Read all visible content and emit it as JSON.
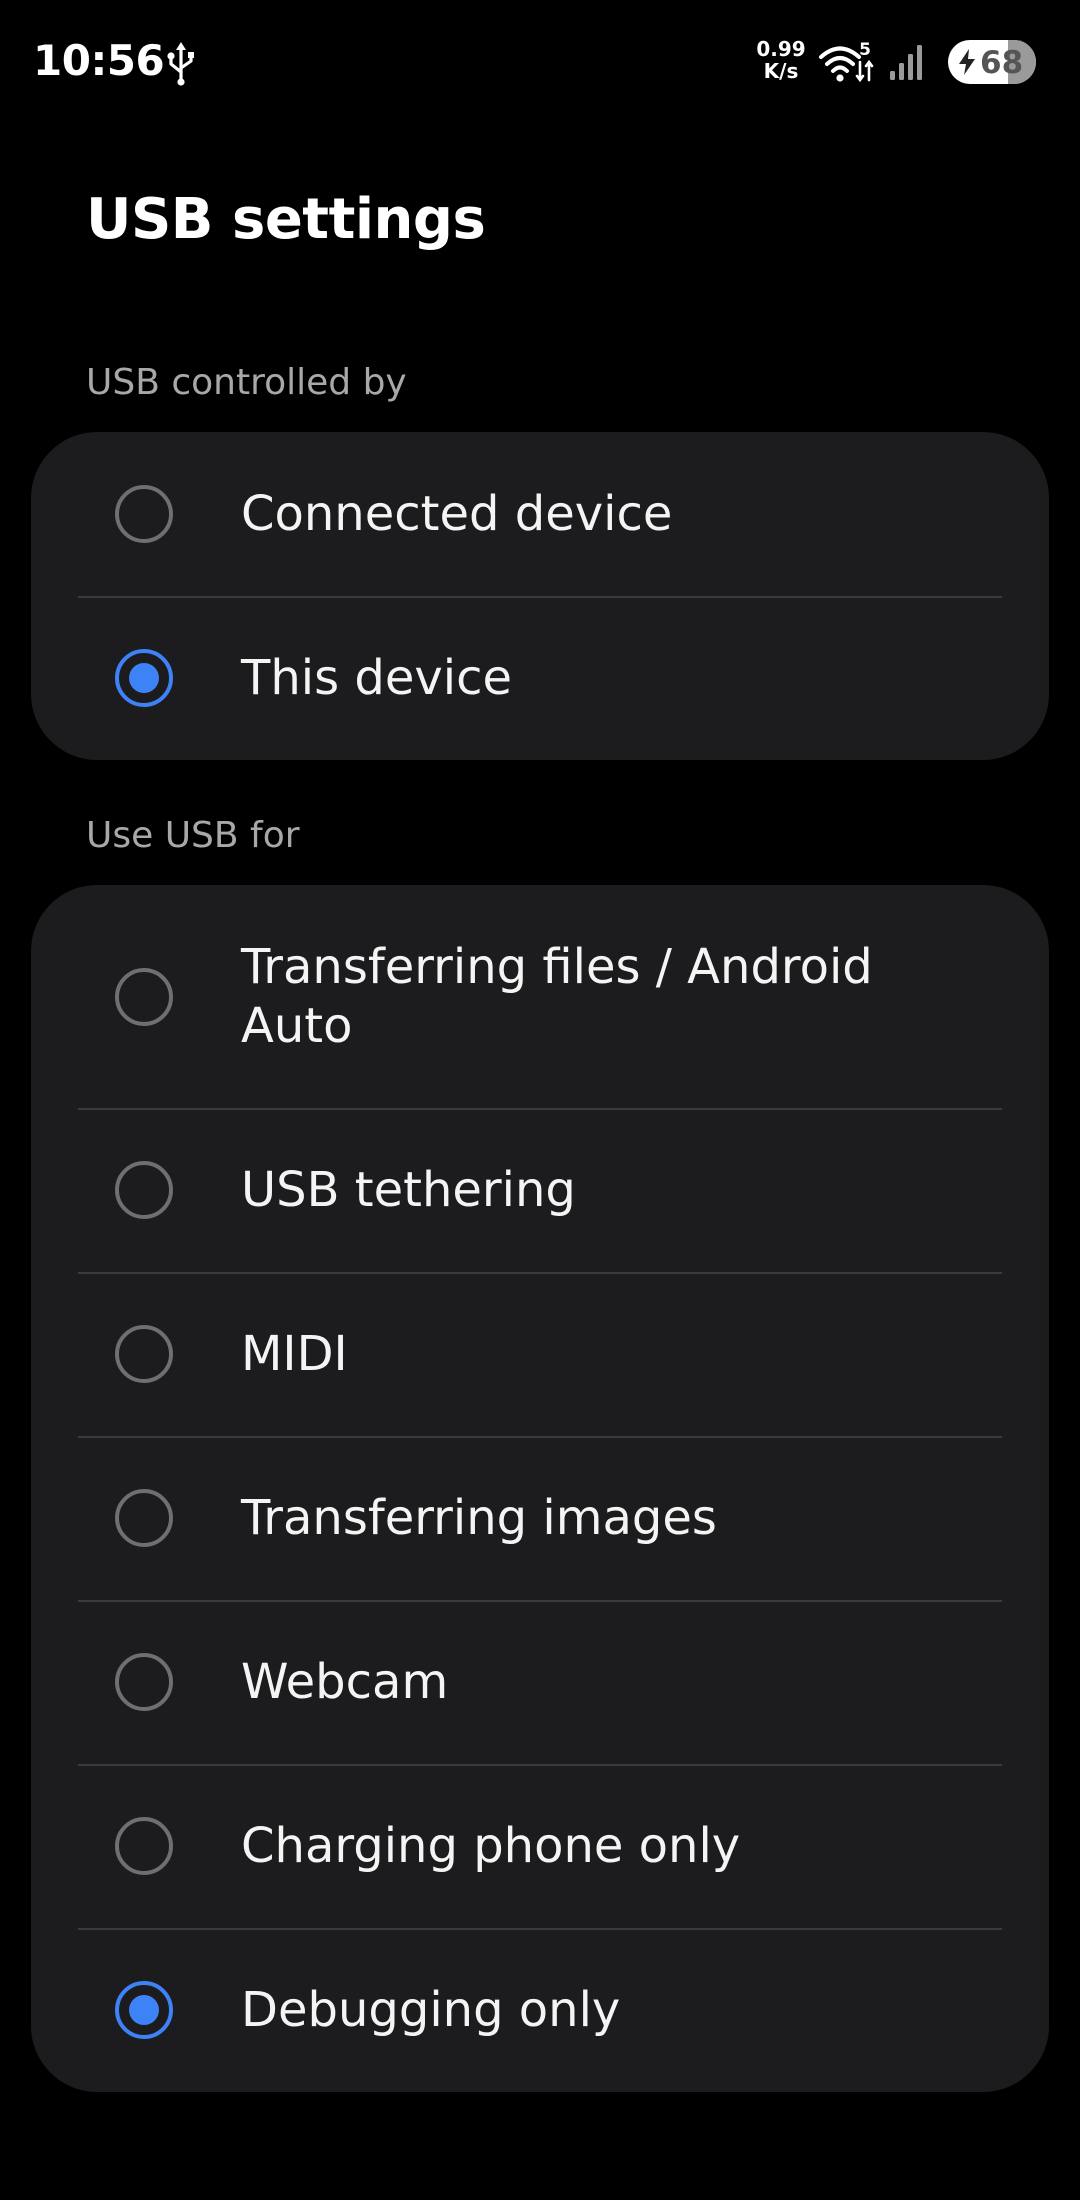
{
  "status_bar": {
    "time": "10:56",
    "usb_icon": "usb-icon",
    "net_speed_value": "0.99",
    "net_speed_unit": "K/s",
    "wifi_icon": "wifi-icon",
    "wifi_badge": "5",
    "signal_icon": "signal-icon",
    "battery_level": "68",
    "battery_fraction": 0.68,
    "battery_charging": true
  },
  "page": {
    "title": "USB settings"
  },
  "controlled_by": {
    "header": "USB controlled by",
    "options": [
      {
        "label": "Connected device",
        "selected": false
      },
      {
        "label": "This device",
        "selected": true
      }
    ]
  },
  "use_usb_for": {
    "header": "Use USB for",
    "options": [
      {
        "label": "Transferring files / Android Auto",
        "selected": false
      },
      {
        "label": "USB tethering",
        "selected": false
      },
      {
        "label": "MIDI",
        "selected": false
      },
      {
        "label": "Transferring images",
        "selected": false
      },
      {
        "label": "Webcam",
        "selected": false
      },
      {
        "label": "Charging phone only",
        "selected": false
      },
      {
        "label": "Debugging only",
        "selected": true
      }
    ]
  },
  "colors": {
    "background": "#000000",
    "card": "#1c1c1e",
    "accent": "#3e82f7",
    "divider": "#3b3b3d",
    "header_text": "#a8a8a8"
  }
}
